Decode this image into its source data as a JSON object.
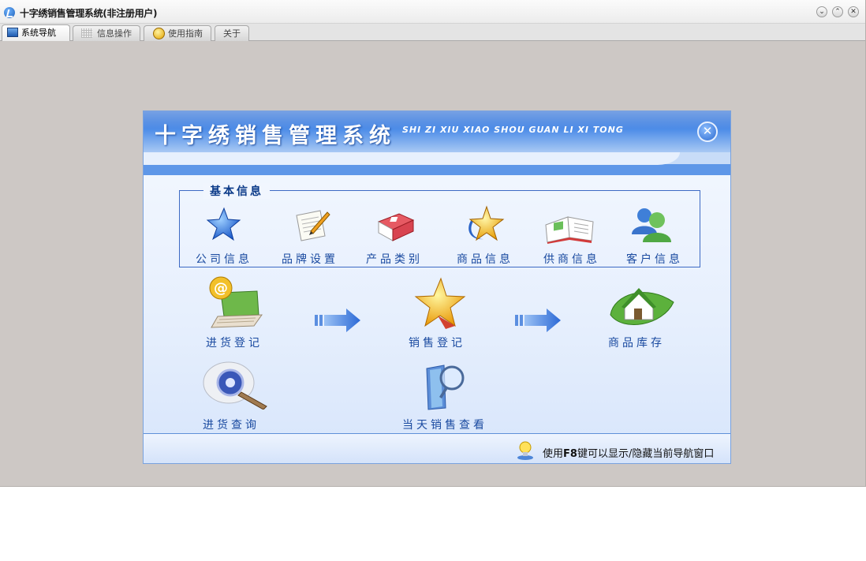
{
  "window": {
    "title": "十字绣销售管理系统(非注册用户)",
    "controls": [
      "minimize",
      "maximize",
      "close"
    ]
  },
  "tabs": [
    {
      "label": "系统导航",
      "icon": "monitor-icon",
      "active": true
    },
    {
      "label": "信息操作",
      "icon": "grid-icon",
      "active": false
    },
    {
      "label": "使用指南",
      "icon": "help-icon",
      "active": false
    },
    {
      "label": "关于",
      "icon": "",
      "active": false
    }
  ],
  "panel": {
    "title": "十字绣销售管理系统",
    "subtitle": "SHI ZI XIU  XIAO SHOU  GUAN LI XI TONG",
    "close_symbol": "✕"
  },
  "basic_info": {
    "legend": "基本信息",
    "items": [
      {
        "label": "公司信息",
        "icon": "blue-star-icon"
      },
      {
        "label": "品牌设置",
        "icon": "notepad-pen-icon"
      },
      {
        "label": "产品类别",
        "icon": "red-book-icon"
      },
      {
        "label": "商品信息",
        "icon": "gold-star-swirl-icon"
      },
      {
        "label": "供商信息",
        "icon": "open-book-icon"
      },
      {
        "label": "客户信息",
        "icon": "users-icon"
      }
    ]
  },
  "workflow": {
    "steps": [
      {
        "label": "进货登记",
        "icon": "laptop-at-icon"
      },
      {
        "label": "销售登记",
        "icon": "gold-star-icon"
      },
      {
        "label": "商品库存",
        "icon": "house-leaf-icon"
      }
    ],
    "queries": [
      {
        "label": "进货查询",
        "icon": "magnifier-disc-icon"
      },
      {
        "label": "当天销售查看",
        "icon": "binder-magnifier-icon"
      }
    ]
  },
  "footer": {
    "tip_prefix": "使用",
    "tip_key": "F8",
    "tip_suffix": "键可以显示/隐藏当前导航窗口"
  },
  "colors": {
    "window_bg": "#cdc8c5",
    "banner_blue": "#2e6fd6",
    "label_blue": "#1a4aa0",
    "border_blue": "#3d6ac4"
  }
}
